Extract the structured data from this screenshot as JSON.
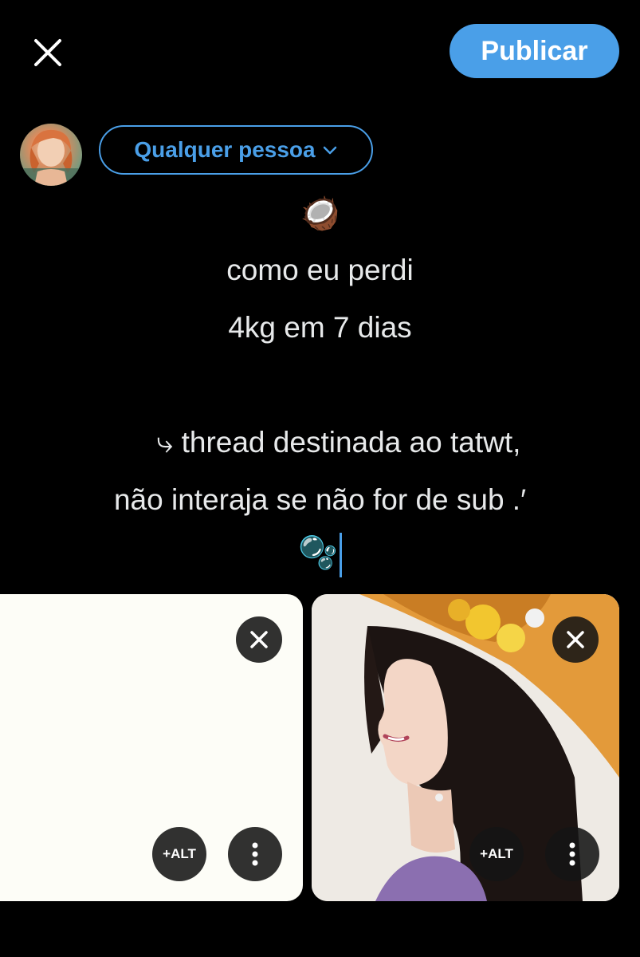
{
  "header": {
    "close_icon": "close-icon",
    "publish_label": "Publicar",
    "accent_color": "#4a9fe8"
  },
  "audience": {
    "label": "Qualquer pessoa",
    "chevron_icon": "chevron-down-icon"
  },
  "composer": {
    "emoji_top": "🥥",
    "lines": [
      "como eu perdi",
      "4kg em 7 dias",
      "⤷ thread destinada ao tatwt,",
      "não interaja se não for de sub .′"
    ],
    "emoji_bottom": "🫧"
  },
  "media": [
    {
      "alt_label": "+ALT",
      "close_icon": "close-icon",
      "more_icon": "vertical-dots-icon"
    },
    {
      "alt_label": "+ALT",
      "close_icon": "close-icon",
      "more_icon": "vertical-dots-icon"
    }
  ]
}
